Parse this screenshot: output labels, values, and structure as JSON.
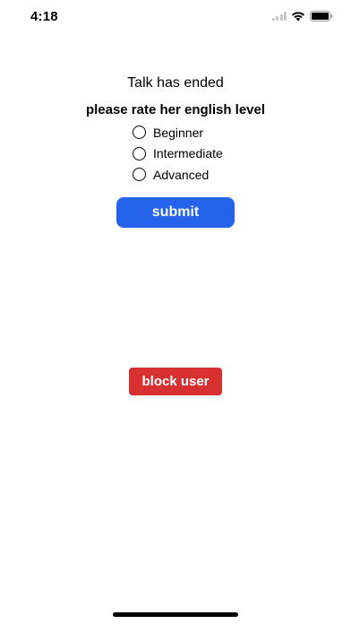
{
  "status_bar": {
    "time": "4:18"
  },
  "main": {
    "title": "Talk has ended",
    "question": "please rate her english level",
    "options": [
      {
        "label": "Beginner",
        "selected": false
      },
      {
        "label": "Intermediate",
        "selected": false
      },
      {
        "label": "Advanced",
        "selected": false
      }
    ],
    "submit_label": "submit",
    "block_label": "block user"
  },
  "colors": {
    "submit_bg": "#2563eb",
    "block_bg": "#d63031"
  },
  "icons": [
    "signal-icon",
    "wifi-icon",
    "battery-icon"
  ]
}
